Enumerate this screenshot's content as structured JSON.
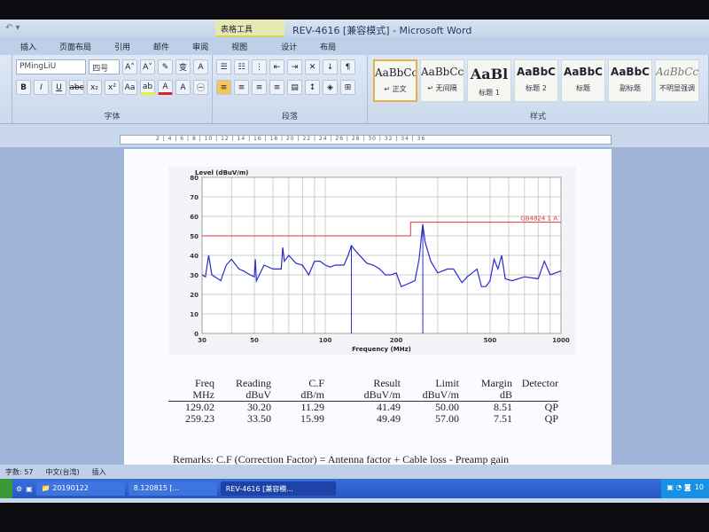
{
  "window": {
    "title": "REV-4616 [兼容模式] - Microsoft Word",
    "context_tab": "表格工具"
  },
  "tabs": [
    "插入",
    "页面布局",
    "引用",
    "邮件",
    "审阅",
    "视图",
    "设计",
    "布局"
  ],
  "font_group": {
    "font": "PMingLiU",
    "size": "四号",
    "label": "字体"
  },
  "paragraph_group": {
    "label": "段落"
  },
  "styles_group": {
    "label": "样式",
    "items": [
      {
        "preview": "AaBbCcI",
        "name": "↵ 正文",
        "selected": true
      },
      {
        "preview": "AaBbCcI",
        "name": "↵ 无间隔"
      },
      {
        "preview": "AaBl",
        "name": "标题 1"
      },
      {
        "preview": "AaBbC",
        "name": "标题 2"
      },
      {
        "preview": "AaBbC",
        "name": "标题"
      },
      {
        "preview": "AaBbC",
        "name": "副标题"
      },
      {
        "preview": "AaBbCc",
        "name": "不明显强调"
      }
    ]
  },
  "ruler": "2 | 4 | 6 | 8 | 10 | 12 | 14 | 16 | 18 | 20 | 22 | 24 | 26 | 28 | 30 | 32 | 34 | 36",
  "chart_data": {
    "type": "line",
    "ylabel": "Level (dBuV/m)",
    "xlabel": "Frequency (MHz)",
    "xscale": "log",
    "xlim": [
      30,
      1000
    ],
    "ylim": [
      0,
      80
    ],
    "xticks": [
      30,
      50,
      100,
      200,
      500,
      1000
    ],
    "yticks": [
      0,
      10,
      20,
      30,
      40,
      50,
      60,
      70,
      80
    ],
    "grid": true,
    "series": [
      {
        "color": "#2a2ad0",
        "points": [
          [
            30,
            30
          ],
          [
            31,
            29
          ],
          [
            32,
            40
          ],
          [
            33,
            30
          ],
          [
            35,
            28
          ],
          [
            36,
            27
          ],
          [
            38,
            35
          ],
          [
            40,
            38
          ],
          [
            43,
            33
          ],
          [
            45,
            32
          ],
          [
            48,
            30
          ],
          [
            50,
            29
          ],
          [
            50.5,
            38
          ],
          [
            51,
            27
          ],
          [
            55,
            35
          ],
          [
            60,
            33
          ],
          [
            65,
            33
          ],
          [
            66,
            44
          ],
          [
            67,
            37
          ],
          [
            70,
            40
          ],
          [
            75,
            36
          ],
          [
            80,
            35
          ],
          [
            85,
            30
          ],
          [
            90,
            37
          ],
          [
            95,
            37
          ],
          [
            100,
            35
          ],
          [
            105,
            34
          ],
          [
            110,
            35
          ],
          [
            120,
            35
          ],
          [
            125,
            40
          ],
          [
            129,
            45
          ],
          [
            135,
            42
          ],
          [
            150,
            36
          ],
          [
            160,
            35
          ],
          [
            170,
            33
          ],
          [
            180,
            30
          ],
          [
            190,
            30
          ],
          [
            200,
            31
          ],
          [
            210,
            24
          ],
          [
            220,
            25
          ],
          [
            240,
            27
          ],
          [
            250,
            38
          ],
          [
            259,
            56
          ],
          [
            265,
            47
          ],
          [
            280,
            37
          ],
          [
            300,
            31
          ],
          [
            330,
            33
          ],
          [
            350,
            33
          ],
          [
            380,
            26
          ],
          [
            400,
            29
          ],
          [
            420,
            31
          ],
          [
            440,
            33
          ],
          [
            460,
            24
          ],
          [
            480,
            24
          ],
          [
            500,
            27
          ],
          [
            520,
            38
          ],
          [
            540,
            33
          ],
          [
            560,
            40
          ],
          [
            580,
            28
          ],
          [
            620,
            27
          ],
          [
            700,
            29
          ],
          [
            800,
            28
          ],
          [
            850,
            37
          ],
          [
            900,
            30
          ],
          [
            1000,
            32
          ]
        ]
      },
      {
        "name": "GB4824 1 A",
        "color": "#d83a3a",
        "points": [
          [
            30,
            50
          ],
          [
            230,
            50
          ],
          [
            230,
            57
          ],
          [
            1000,
            57
          ]
        ]
      }
    ],
    "markers": [
      129.02,
      259.23
    ]
  },
  "table": {
    "headers": [
      [
        "Freq",
        "MHz"
      ],
      [
        "Reading",
        "dBuV"
      ],
      [
        "C.F",
        "dB/m"
      ],
      [
        "Result",
        "dBuV/m"
      ],
      [
        "Limit",
        "dBuV/m"
      ],
      [
        "Margin",
        "dB"
      ],
      [
        "Detector",
        ""
      ]
    ],
    "rows": [
      [
        "129.02",
        "30.20",
        "11.29",
        "41.49",
        "50.00",
        "8.51",
        "QP"
      ],
      [
        "259.23",
        "33.50",
        "15.99",
        "49.49",
        "57.00",
        "7.51",
        "QP"
      ]
    ]
  },
  "remarks": "Remarks:   C.F (Correction Factor) = Antenna factor + Cable loss - Preamp gain",
  "status": {
    "words": "字数: 57",
    "lang": "中文(台湾)",
    "mode": "插入"
  },
  "taskbar": {
    "items": [
      "20190122",
      "8.120815 [...",
      "REV-4616 [兼容模..."
    ],
    "clock": "10"
  }
}
